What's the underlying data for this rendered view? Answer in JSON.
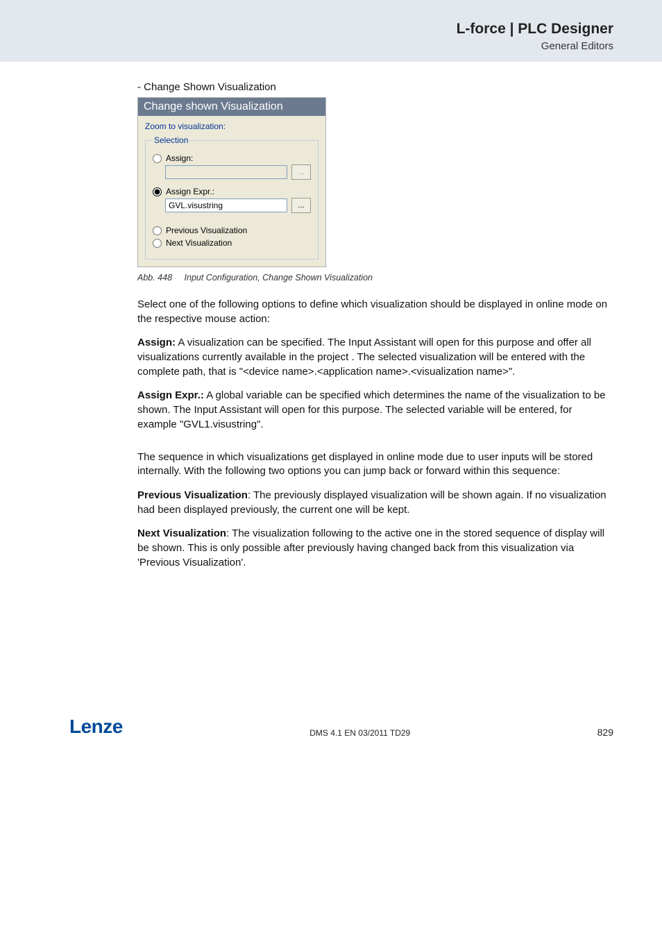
{
  "header": {
    "title": "L-force | PLC Designer",
    "subtitle": "General Editors"
  },
  "section_lead": "- Change Shown Visualization",
  "dialog": {
    "title": "Change shown Visualization",
    "zoom": "Zoom to visualization:",
    "legend": "Selection",
    "assign": {
      "label": "Assign:",
      "value": "",
      "btn": "..."
    },
    "assign_expr": {
      "label": "Assign Expr.:",
      "value": "GVL.visustring",
      "btn": "..."
    },
    "prev": "Previous Visualization",
    "next": "Next Visualization"
  },
  "caption": {
    "num": "Abb. 448",
    "text": "Input Configuration, Change Shown Visualization"
  },
  "paras": {
    "p1": "Select one of the following options to define which visualization should be displayed in online mode on the respective mouse action:",
    "p2_lead": "Assign:",
    "p2_body": " A visualization can be specified. The Input Assistant will open for this purpose and offer all visualizations currently available in the project . The selected visualization will be entered with the complete path, that is \"<device name>.<application name>.<visualization name>\".",
    "p3_lead": "Assign Expr.:",
    "p3_body": " A global variable can be specified which determines the name of the visualization to be shown. The Input Assistant will open for this purpose. The selected variable will be entered, for example \"GVL1.visustring\".",
    "p4": "The sequence in which visualizations get displayed in online mode due to user inputs will be stored internally. With the following two options you can jump back or forward within this sequence:",
    "p5_lead": "Previous Visualization",
    "p5_body": ": The previously displayed visualization will be shown again. If no visualization had been displayed previously, the current one will be kept.",
    "p6_lead": "Next Visualization",
    "p6_body": ":   The visualization following to the active one in the stored sequence of display will be shown. This is only possible after previously having changed back from this visualization via 'Previous Visualization'."
  },
  "footer": {
    "logo": "Lenze",
    "center": "DMS 4.1 EN 03/2011 TD29",
    "page": "829"
  }
}
